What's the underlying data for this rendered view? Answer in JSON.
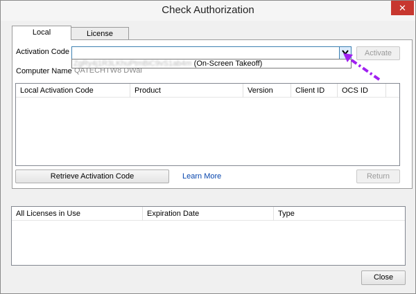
{
  "window": {
    "title": "Check Authorization",
    "close_glyph": "✕"
  },
  "tabs": [
    {
      "label": "Local"
    },
    {
      "label": "License Manager"
    }
  ],
  "local": {
    "activation_code_label": "Activation Code",
    "activation_dropdown_suffix": "(On-Screen Takeoff)",
    "activation_dropdown_blurred": "ZgRy4j1R3LKhuPtmBiC9vS1ab4m",
    "activate_label": "Activate",
    "computer_name_label": "Computer Name",
    "computer_name_value": "QATECHTW8 DWal",
    "table_headers": [
      "Local Activation Code",
      "Product",
      "Version",
      "Client ID",
      "OCS ID"
    ],
    "retrieve_label": "Retrieve Activation Code",
    "learn_more_label": "Learn More",
    "return_label": "Return"
  },
  "licenses": {
    "table_headers": [
      "All Licenses in Use",
      "Expiration Date",
      "Type"
    ]
  },
  "close_label": "Close",
  "colors": {
    "annotation_arrow": "#a020f0",
    "link": "#0645ad",
    "close_button": "#c7372f"
  }
}
